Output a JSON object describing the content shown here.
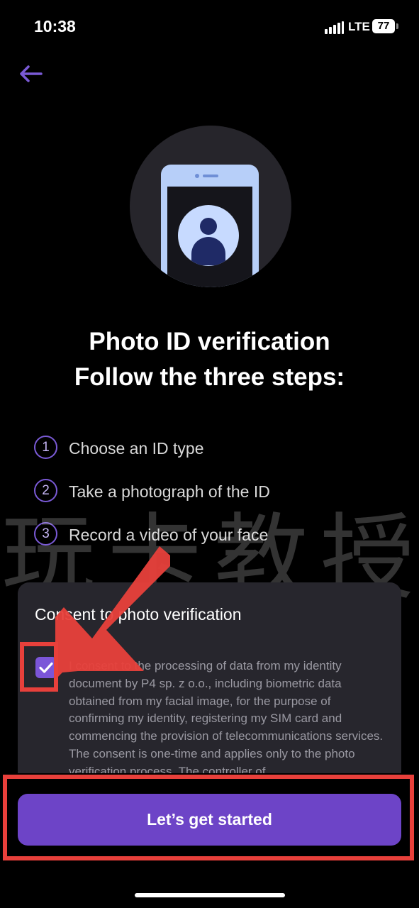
{
  "status_bar": {
    "time": "10:38",
    "network": "LTE",
    "battery": "77"
  },
  "icons": {
    "back": "arrow-left-icon",
    "hero": "phone-person-icon",
    "check": "checkmark-icon"
  },
  "colors": {
    "accent": "#6d44c7",
    "card": "#27262d",
    "annotation": "#e8403b"
  },
  "header": {
    "title_line1": "Photo ID verification",
    "title_line2": "Follow the three steps:"
  },
  "steps": [
    {
      "number": "1",
      "label": "Choose an ID type"
    },
    {
      "number": "2",
      "label": "Take a photograph of the ID"
    },
    {
      "number": "3",
      "label": "Record a video of your face"
    }
  ],
  "watermark": "玩卡教授",
  "consent": {
    "title": "Consent to photo verification",
    "checked": true,
    "text": "I consent to the processing of data from my identity document by P4 sp. z o.o., including biometric data obtained from my facial image, for the purpose of confirming my identity, registering my SIM card and commencing the provision of telecommunications services. The consent is one-time and applies only to the photo verification process. The controller of"
  },
  "cta": {
    "label": "Let’s get started"
  }
}
